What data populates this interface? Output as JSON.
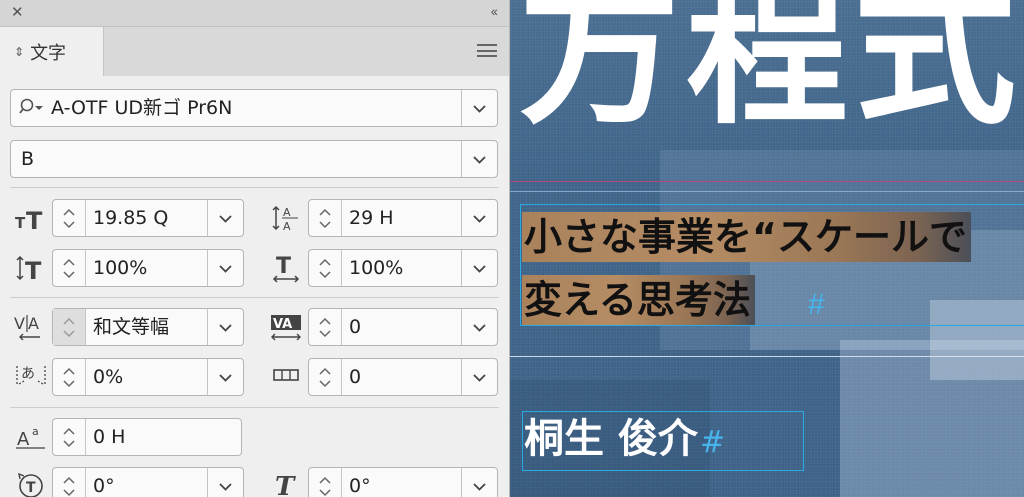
{
  "panel": {
    "tab_label": "文字",
    "font_family": "A-OTF UD新ゴ Pr6N",
    "font_style": "B",
    "fields": {
      "font_size": "19.85 Q",
      "leading": "29 H",
      "vertical_scale": "100%",
      "horizontal_scale": "100%",
      "kerning": "和文等幅",
      "tracking": "0",
      "tsume": "0%",
      "aki": "0",
      "baseline_shift": "0 H",
      "rotation": "0°",
      "skew": "0°"
    }
  },
  "canvas": {
    "title_fragment": "方程式",
    "subtitle_line1": "小さな事業を“スケールで",
    "subtitle_line2": "変える思考法",
    "author": "桐生 俊介",
    "end_mark": "#"
  }
}
